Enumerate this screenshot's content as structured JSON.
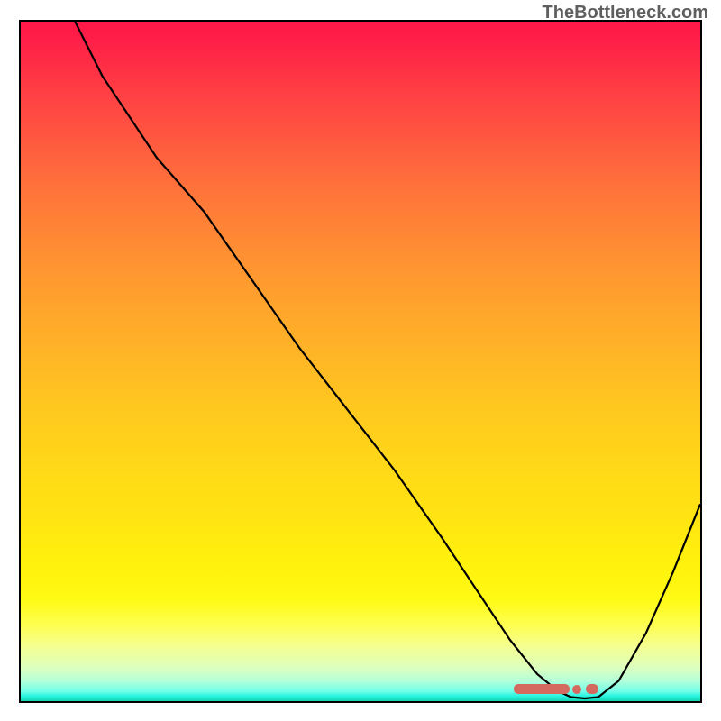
{
  "watermark": "TheBottleneck.com",
  "chart_data": {
    "type": "line",
    "title": "",
    "xlabel": "",
    "ylabel": "",
    "xlim": [
      0,
      100
    ],
    "ylim": [
      0,
      100
    ],
    "grid": false,
    "series": [
      {
        "name": "bottleneck-curve",
        "x": [
          8,
          12,
          20,
          27,
          34,
          41,
          48,
          55,
          62,
          68,
          72,
          76,
          79,
          81,
          83,
          85,
          88,
          92,
          96,
          100
        ],
        "values": [
          100,
          92,
          80,
          72,
          62,
          52,
          43,
          34,
          24,
          15,
          9,
          4,
          1.5,
          0.6,
          0.4,
          0.6,
          3,
          10,
          19,
          29
        ]
      }
    ],
    "markers": {
      "name": "optimal-range",
      "x_start": 74,
      "x_end": 86,
      "y": 1.3
    },
    "background_gradient": {
      "top": "#ff1749",
      "mid": "#ffca1e",
      "bottom": "#13d3ad"
    }
  }
}
